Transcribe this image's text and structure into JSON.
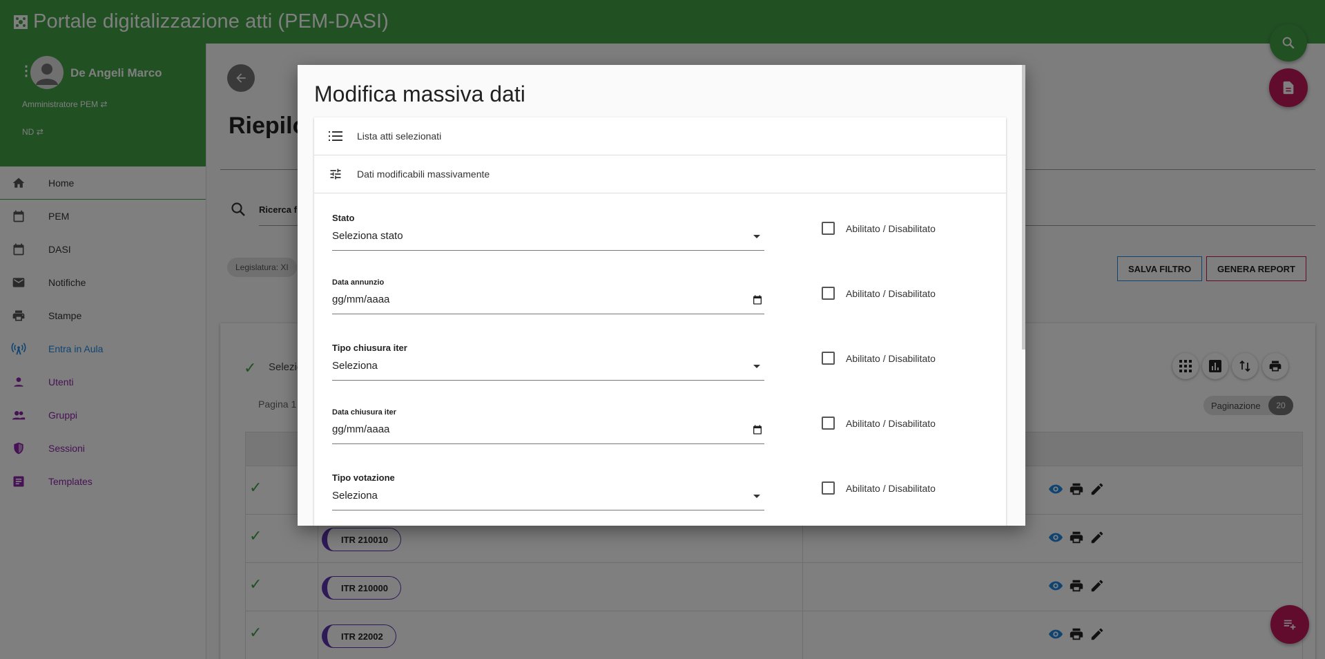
{
  "header": {
    "title": "Portale digitalizzazione atti (PEM-DASI)"
  },
  "user": {
    "name": "De Angeli Marco",
    "role": "Amministratore PEM",
    "group": "ND"
  },
  "sidebar": {
    "items": [
      {
        "label": "Home",
        "icon": "home-icon"
      },
      {
        "label": "PEM",
        "icon": "calendar-icon"
      },
      {
        "label": "DASI",
        "icon": "calendar-icon"
      },
      {
        "label": "Notifiche",
        "icon": "mail-icon"
      },
      {
        "label": "Stampe",
        "icon": "print-icon"
      },
      {
        "label": "Entra in Aula",
        "icon": "antenna-icon"
      },
      {
        "label": "Utenti",
        "icon": "person-icon"
      },
      {
        "label": "Gruppi",
        "icon": "group-icon"
      },
      {
        "label": "Sessioni",
        "icon": "shield-icon"
      },
      {
        "label": "Templates",
        "icon": "document-icon"
      }
    ]
  },
  "main": {
    "title": "Riepilo",
    "search_label": "Ricerca f",
    "chip_legislatura": "Legislatura: XI",
    "btn_salva": "SALVA FILTRO",
    "btn_report": "GENERA REPORT",
    "selected_label": "Selezio",
    "page_label": "Pagina 1",
    "pagination_label": "Paginazione",
    "pagination_count": "20",
    "rows": [
      {
        "code": ""
      },
      {
        "code": "ITR 210010"
      },
      {
        "code": "ITR 210000"
      },
      {
        "code": "ITR 22002"
      }
    ]
  },
  "modal": {
    "title": "Modifica massiva dati",
    "section_list": "Lista atti selezionati",
    "section_edit": "Dati modificabili massivamente",
    "fields": [
      {
        "label": "Stato",
        "value": "Seleziona stato",
        "type": "select"
      },
      {
        "label": "Data annunzio",
        "value": "gg/mm/aaaa",
        "type": "date"
      },
      {
        "label": "Tipo chiusura iter",
        "value": "Seleziona",
        "type": "select"
      },
      {
        "label": "Data chiusura iter",
        "value": "gg/mm/aaaa",
        "type": "date"
      },
      {
        "label": "Tipo votazione",
        "value": "Seleziona",
        "type": "select"
      }
    ],
    "checkbox_label": "Abilitato / Disabilitato"
  },
  "colors": {
    "brand_green": "#43a047",
    "accent_pink": "#c2185b",
    "link_blue": "#1e88e5",
    "purple": "#8e24aa"
  }
}
